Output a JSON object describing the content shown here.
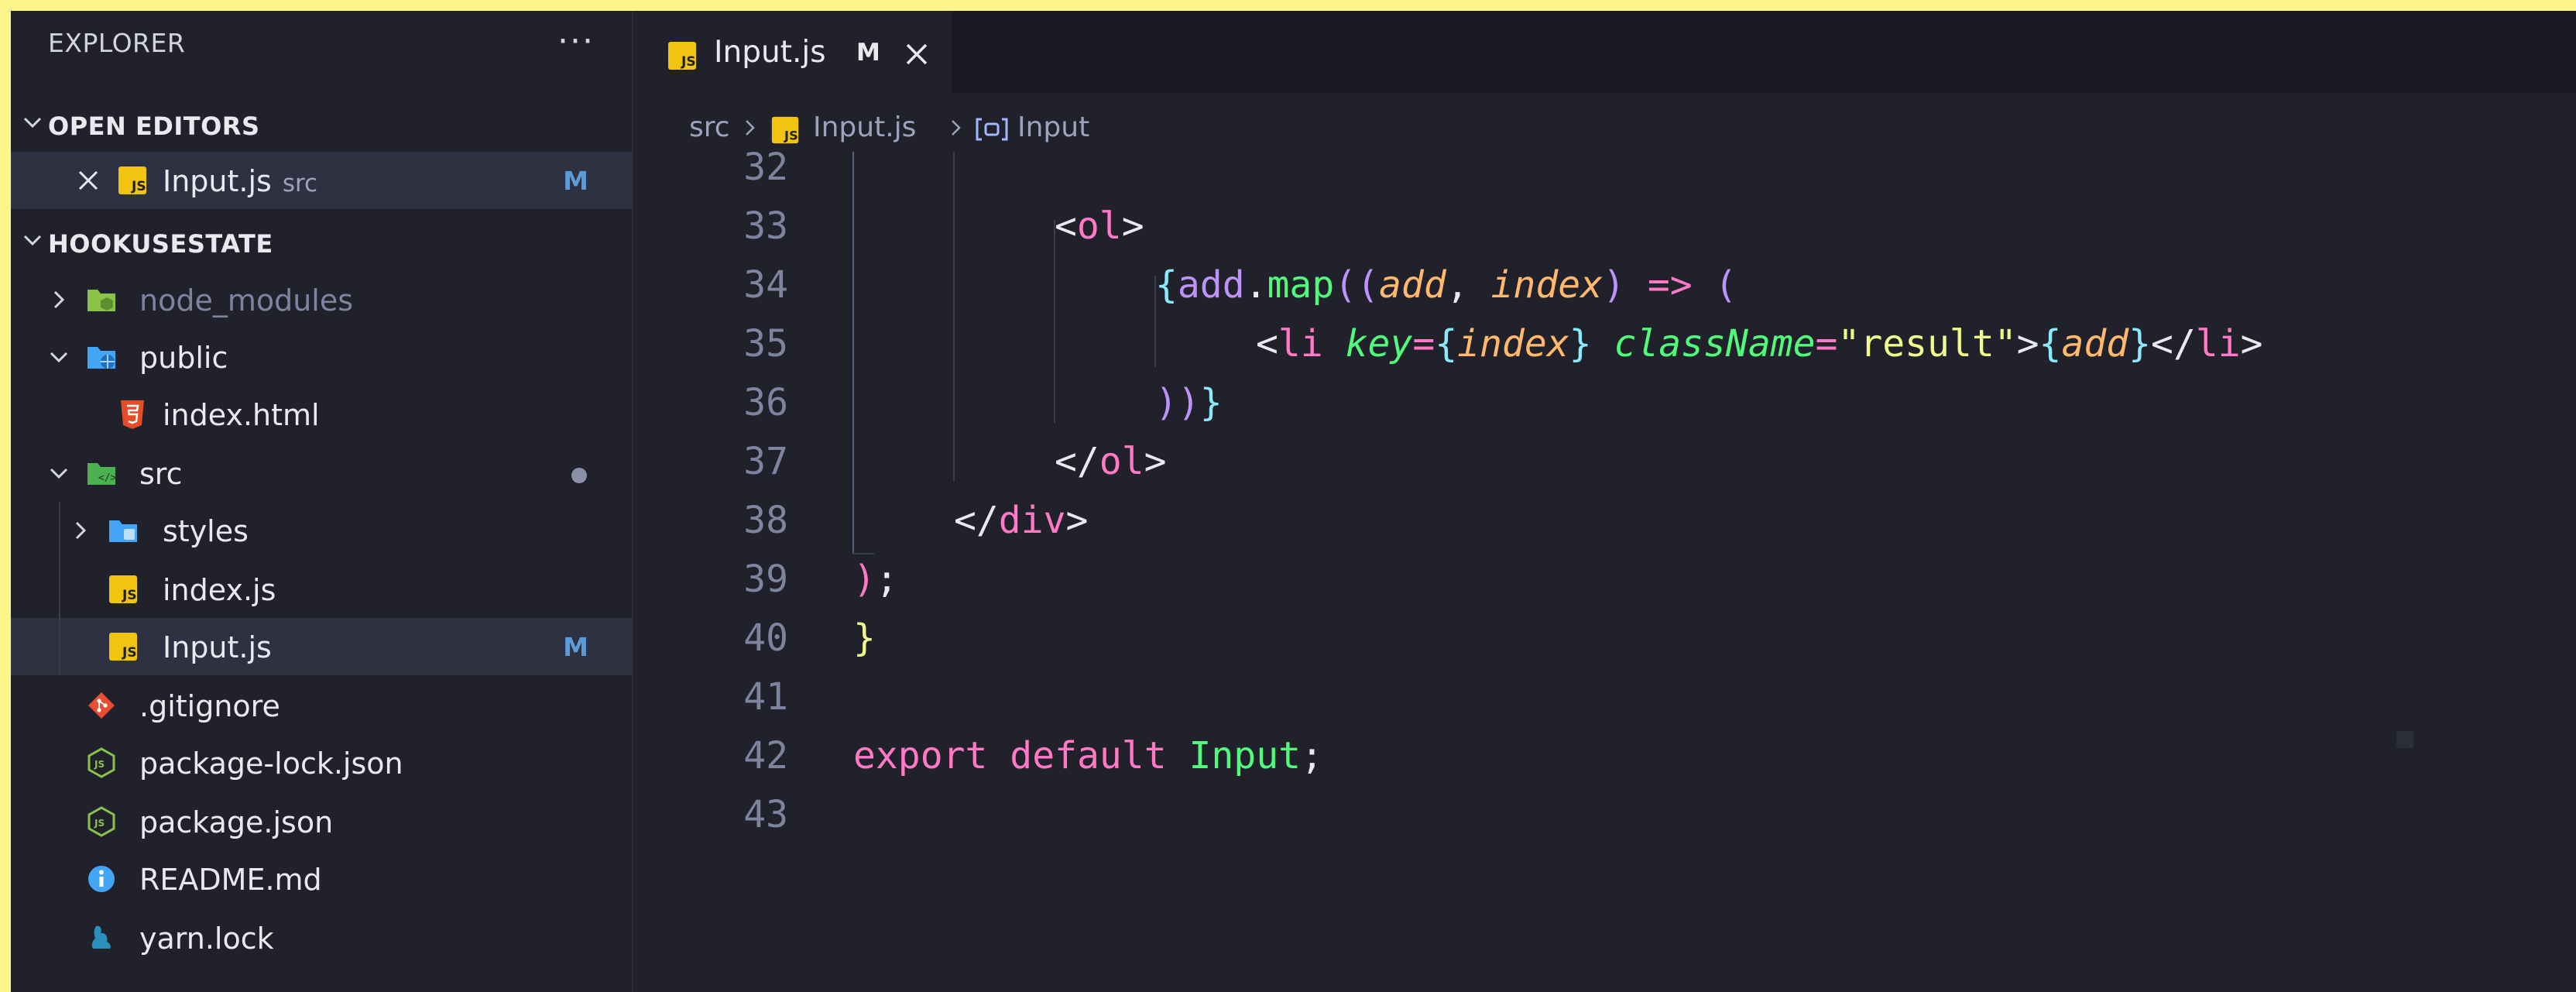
{
  "sidebar": {
    "title": "EXPLORER",
    "more": "···",
    "open_editors": {
      "header": "OPEN EDITORS",
      "items": [
        {
          "name": "Input.js",
          "description": "src",
          "badge": "M"
        }
      ]
    },
    "project": {
      "header": "HOOKUSESTATE",
      "items": [
        {
          "name": "node_modules"
        },
        {
          "name": "public"
        },
        {
          "name": "index.html"
        },
        {
          "name": "src"
        },
        {
          "name": "styles"
        },
        {
          "name": "index.js"
        },
        {
          "name": "Input.js",
          "badge": "M"
        },
        {
          "name": ".gitignore"
        },
        {
          "name": "package-lock.json"
        },
        {
          "name": "package.json"
        },
        {
          "name": "README.md"
        },
        {
          "name": "yarn.lock"
        }
      ]
    }
  },
  "editor": {
    "tab": {
      "name": "Input.js",
      "badge": "M"
    },
    "breadcrumb": [
      "src",
      "Input.js",
      "Input"
    ],
    "lines": [
      {
        "num": "32"
      },
      {
        "num": "33",
        "t": [
          "<",
          "ol",
          ">"
        ]
      },
      {
        "num": "34",
        "t": [
          "{",
          "add",
          ".",
          "map",
          "((",
          "add",
          ", ",
          "index",
          ") ",
          "=>",
          " ("
        ]
      },
      {
        "num": "35",
        "t": [
          "<",
          "li",
          " ",
          "key",
          "=",
          "{",
          "index",
          "}",
          " ",
          "className",
          "=",
          "\"result\"",
          ">",
          "{",
          "add",
          "}",
          "</",
          "li",
          ">"
        ]
      },
      {
        "num": "36",
        "t": [
          "))",
          "}"
        ]
      },
      {
        "num": "37",
        "t": [
          "</",
          "ol",
          ">"
        ]
      },
      {
        "num": "38",
        "t": [
          "</",
          "div",
          ">"
        ]
      },
      {
        "num": "39",
        "t": [
          ")",
          ";"
        ]
      },
      {
        "num": "40",
        "t": [
          "}"
        ]
      },
      {
        "num": "41"
      },
      {
        "num": "42",
        "t": [
          "export",
          " ",
          "default",
          " ",
          "Input",
          ";"
        ]
      },
      {
        "num": "43"
      }
    ]
  },
  "colors": {
    "background": "#20212b",
    "tabbar": "#191a21",
    "frame": "#fdf58a",
    "modified": "#5d9bd6",
    "js_icon": "#f1c40f",
    "tag": "#ff79c6",
    "function": "#50fa7b",
    "parameter": "#ffb86c",
    "string": "#f1fa8c"
  }
}
